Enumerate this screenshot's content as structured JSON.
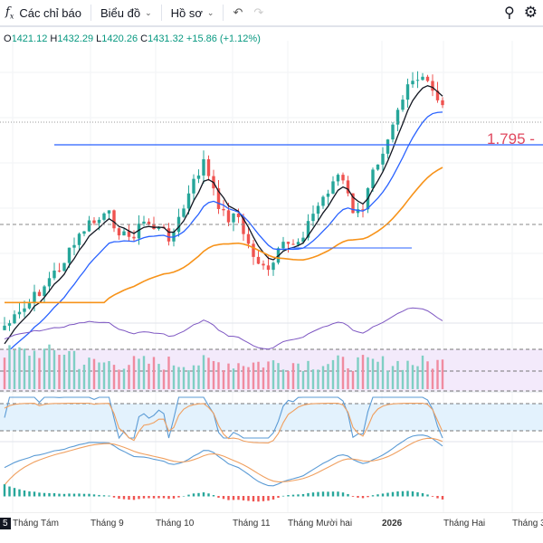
{
  "toolbar": {
    "indicators": "Các chỉ báo",
    "chart": "Biểu đồ",
    "profile": "Hồ sơ"
  },
  "ohlc": {
    "o_label": "O",
    "o": "1421.12",
    "h_label": "H",
    "h": "1432.29",
    "l_label": "L",
    "l": "1420.26",
    "c_label": "C",
    "c": "1431.32",
    "change": "+15.86 (+1.12%)"
  },
  "level_label": "1.795 -",
  "axis": {
    "first": "5",
    "labels": [
      "Tháng Tám",
      "Tháng 9",
      "Tháng 10",
      "Tháng 11",
      "Tháng Mười hai",
      "2026",
      "Tháng Hai",
      "Tháng 3"
    ]
  },
  "colors": {
    "up": "#26a69a",
    "down": "#ef5350",
    "ema_fast": "#131722",
    "ema_mid": "#2962ff",
    "ema_slow": "#f7931a",
    "level": "#e0495f"
  }
}
